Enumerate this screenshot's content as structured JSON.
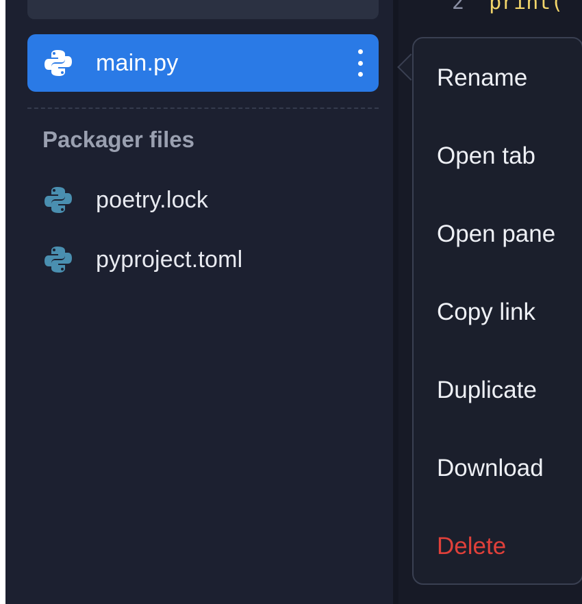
{
  "editor": {
    "line_number": "2",
    "code_text": "print("
  },
  "files": {
    "selected": {
      "name": "main.py",
      "icon": "python-icon"
    },
    "section_heading": "Packager files",
    "packager_items": [
      {
        "name": "poetry.lock",
        "icon": "python-icon"
      },
      {
        "name": "pyproject.toml",
        "icon": "python-icon"
      }
    ]
  },
  "context_menu": {
    "items": [
      "Rename",
      "Open tab",
      "Open pane",
      "Copy link",
      "Duplicate",
      "Download",
      "Delete"
    ]
  },
  "colors": {
    "selected_bg": "#2a7ae6",
    "sidebar_bg": "#1c2030",
    "delete_text": "#e0403a",
    "python_icon_muted": "#4a8fb0",
    "python_icon_active": "#ffffff"
  }
}
